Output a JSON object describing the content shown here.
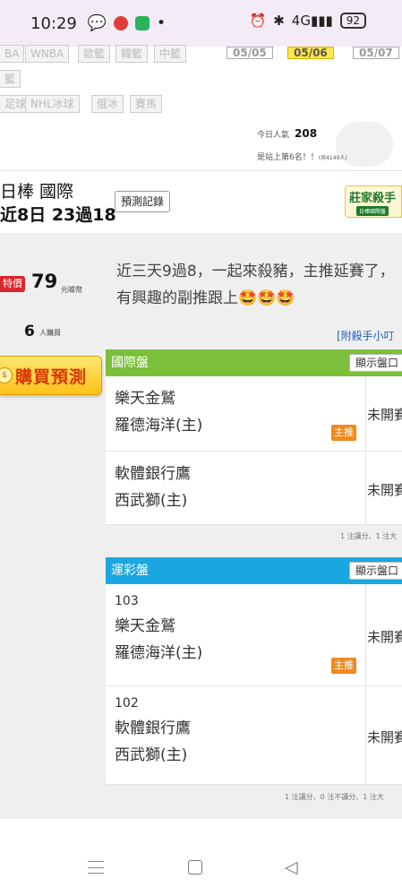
{
  "status_bar": {
    "time": "10:29",
    "signal_text": "4G",
    "battery": "92"
  },
  "top_nav": {
    "chips_row1": [
      "BA",
      "WNBA",
      "歐籃",
      "韓籃",
      "中籃"
    ],
    "chips_row2": [
      "籃"
    ],
    "chips_row3": [
      "足球",
      "NHL冰球",
      "俄冰",
      "賽馬"
    ],
    "dates": [
      "05/05",
      "05/06",
      "05/07"
    ],
    "popular_label": "今日人氣",
    "popular_count": "208",
    "rank_text": "是站上第6名！！",
    "rank_small": "(共4149人)"
  },
  "header": {
    "title": "日棒 國際",
    "record": "近8日 23過18",
    "record_button": "預測記錄",
    "brand_name": "莊家殺手",
    "brand_sub": "日棒國際盤"
  },
  "sidebar": {
    "special_badge": "特價",
    "price": "79",
    "price_unit": "元噱幣",
    "buyers": "6",
    "buyers_unit": "人購買",
    "buy_button": "購買預測",
    "buy_icon_text": "$"
  },
  "content": {
    "description": "近三天9過8，一起來殺豬，主推延賽了，有興趣的副推跟上🤩🤩🤩",
    "attach_link": "[附殺手小叮"
  },
  "intl_panel": {
    "title": "國際盤",
    "toggle": "顯示盤口",
    "games": [
      {
        "away": "樂天金鷲",
        "home": "羅德海洋(主)",
        "status": "未開賽",
        "tag": "主推"
      },
      {
        "away": "軟體銀行鷹",
        "home": "西武獅(主)",
        "status": "未開賽",
        "tag": ""
      }
    ],
    "footnote": "1 注讓分、1 注大"
  },
  "lottery_panel": {
    "title": "運彩盤",
    "toggle": "顯示盤口",
    "games": [
      {
        "code": "103",
        "away": "樂天金鷲",
        "home": "羅德海洋(主)",
        "status": "未開賽",
        "tag": "主推"
      },
      {
        "code": "102",
        "away": "軟體銀行鷹",
        "home": "西武獅(主)",
        "status": "未開賽",
        "tag": ""
      }
    ],
    "footnote": "1 注讓分、0 注不讓分、1 注大"
  },
  "nav_bar": {
    "menu_icon": "menu-icon",
    "home_icon": "home-icon",
    "back_icon": "back-icon",
    "back_glyph": "◁"
  }
}
